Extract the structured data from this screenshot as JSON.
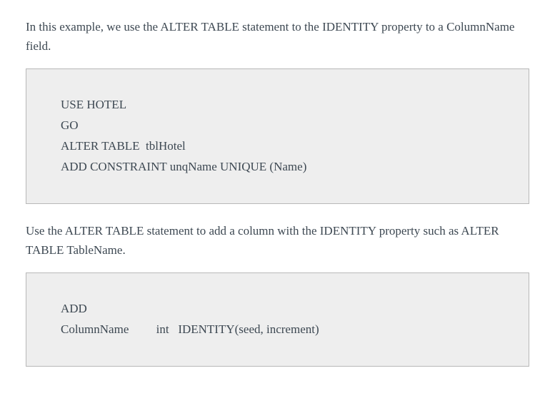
{
  "paragraph1": "In this example, we use the ALTER TABLE statement to the IDENTITY property to a ColumnName field.",
  "code1": "USE HOTEL\nGO\nALTER TABLE  tblHotel\nADD CONSTRAINT unqName UNIQUE (Name)",
  "paragraph2": "Use the ALTER TABLE statement to add a column with the IDENTITY property such as ALTER TABLE TableName.",
  "code2": "ADD\nColumnName         int   IDENTITY(seed, increment)"
}
